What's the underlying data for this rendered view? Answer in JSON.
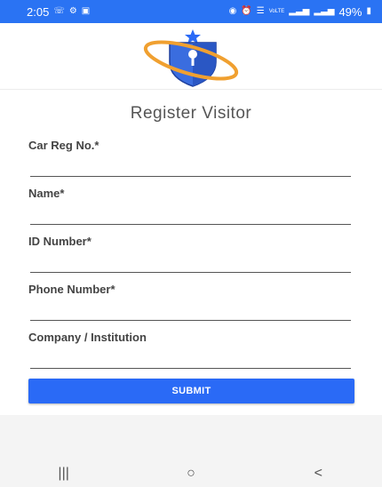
{
  "status_bar": {
    "time": "2:05",
    "left_icons": [
      "whatsapp-icon",
      "settings-icon",
      "gallery-icon"
    ],
    "right_icons": [
      "camera-icon",
      "alarm-icon",
      "wifi-icon",
      "volte-icon",
      "signal-icon",
      "signal-icon",
      "battery-icon"
    ],
    "network_label": "VoLTE",
    "battery": "49%"
  },
  "header": {
    "logo": "shield-star-logo"
  },
  "form": {
    "title": "Register Visitor",
    "fields": [
      {
        "label": "Car Reg No.*",
        "value": "",
        "placeholder": ""
      },
      {
        "label": "Name*",
        "value": "",
        "placeholder": ""
      },
      {
        "label": "ID Number*",
        "value": "",
        "placeholder": ""
      },
      {
        "label": "Phone Number*",
        "value": "",
        "placeholder": ""
      },
      {
        "label": "Company / Institution",
        "value": "",
        "placeholder": ""
      }
    ],
    "submit_label": "SUBMIT"
  },
  "nav_bar": {
    "recents": "|||",
    "home": "○",
    "back": "<"
  },
  "colors": {
    "accent": "#2a6af6",
    "status_bar": "#2a73f3",
    "logo_orange": "#f0a030"
  }
}
